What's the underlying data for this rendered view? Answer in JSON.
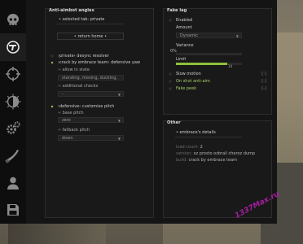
{
  "sidebar": {
    "items": [
      {
        "icon": "skull-icon"
      },
      {
        "icon": "crosshair-pistol-icon",
        "active": true
      },
      {
        "icon": "crosshair-icon"
      },
      {
        "icon": "visuals-icon"
      },
      {
        "icon": "gears-icon"
      },
      {
        "icon": "knife-icon"
      },
      {
        "icon": "player-icon"
      },
      {
        "icon": "save-icon"
      }
    ]
  },
  "anti_aimbot": {
    "title": "Anti-aimbot angles",
    "selected_tab": "• selected tab: private",
    "return_home": "• return home •",
    "private_desync": "›private‹ desync resolver",
    "crack_defensive": "›crack by embrace team‹ defensive yaw",
    "allow_in_state": "›‹ allow in state",
    "allow_in_state_value": "standing, moving, ducking,",
    "additional_checks": "›‹ additional checks",
    "additional_checks_value": "-",
    "defensive_customise": "›defensive‹ customise pitch",
    "base_pitch": "›‹ base pitch",
    "base_pitch_value": "zero",
    "fallback_pitch": "›‹ fallback pitch",
    "fallback_pitch_value": "down"
  },
  "fake_lag": {
    "title": "Fake lag",
    "enabled": "Enabled",
    "amount_label": "Amount",
    "amount_value": "Dynamic",
    "variance_label": "Variance",
    "variance_value": "0%",
    "variance_fraction": 0.0,
    "limit_label": "Limit",
    "limit_fraction": 0.78,
    "limit_value": "14",
    "slow_motion": "Slow motion",
    "on_shot": "On shot anti-aim",
    "fake_peek": "Fake peek",
    "key_placeholder": "[-]"
  },
  "other": {
    "title": "Other",
    "header": "• embrace's details",
    "load_count_label": "load count:",
    "load_count_value": "2",
    "version_label": "version:",
    "version_value": "xz prosto ozbrali cheroz dump",
    "build_label": "build:",
    "build_value": "crack by embrace team"
  },
  "watermark": "1337Мах.ru",
  "colors": {
    "accent": "#8fbf3a",
    "green_text": "#a7d16a",
    "watermark": "#b51fb0"
  }
}
